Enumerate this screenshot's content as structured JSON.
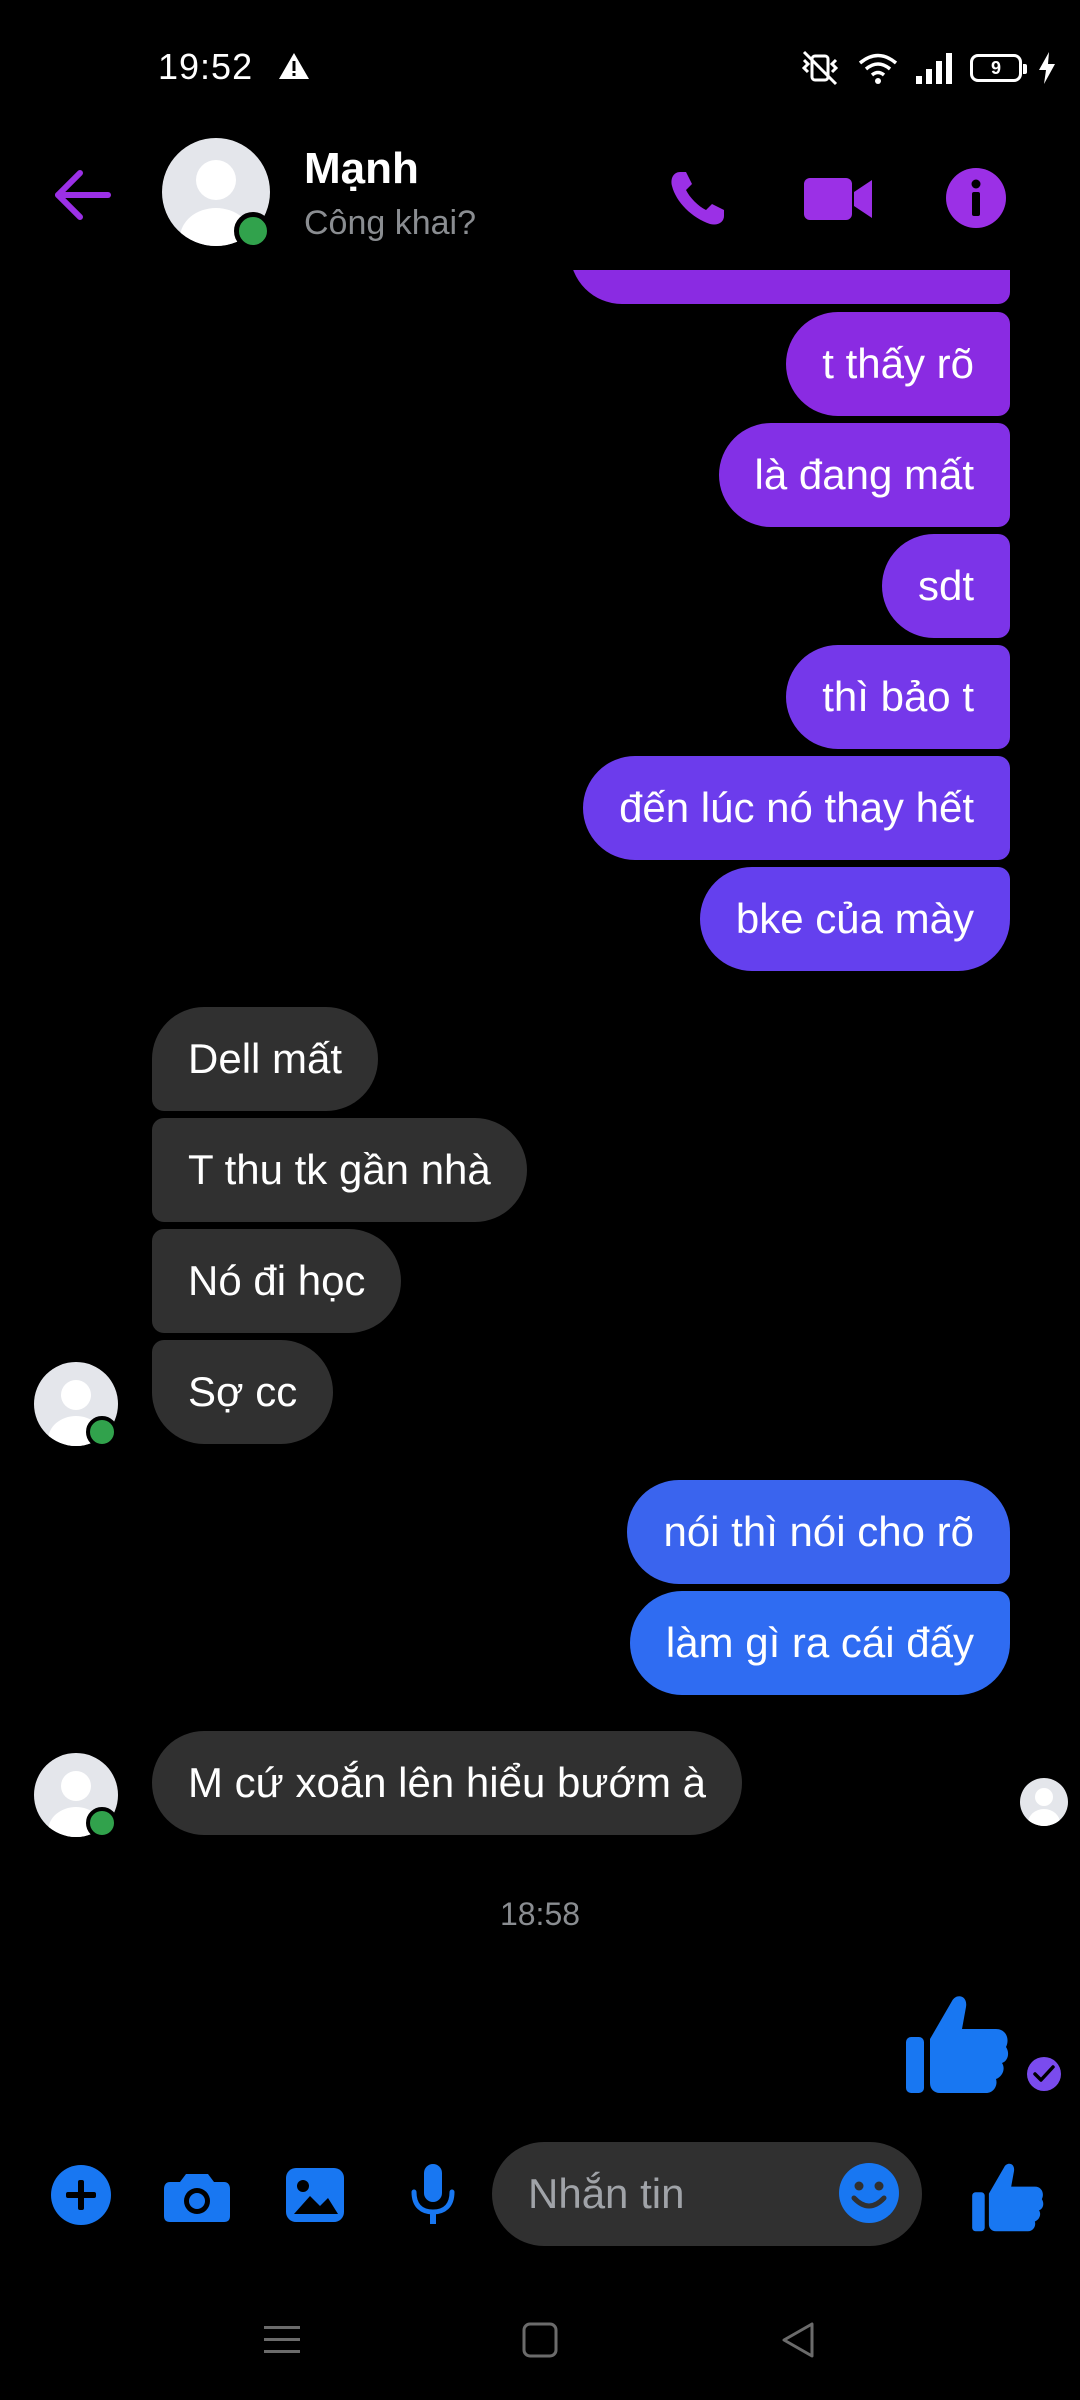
{
  "status_bar": {
    "time": "19:52",
    "battery_level": "9"
  },
  "header": {
    "contact_name": "Mạnh",
    "contact_status": "Công khai?"
  },
  "messages": [
    {
      "dir": "out",
      "text": "t thấy rõ"
    },
    {
      "dir": "out",
      "text": "là đang mất"
    },
    {
      "dir": "out",
      "text": "sdt"
    },
    {
      "dir": "out",
      "text": "thì bảo t"
    },
    {
      "dir": "out",
      "text": "đến lúc nó thay hết"
    },
    {
      "dir": "out",
      "text": "bke của mày"
    },
    {
      "dir": "in",
      "text": "Dell mất"
    },
    {
      "dir": "in",
      "text": "T thu tk gần nhà"
    },
    {
      "dir": "in",
      "text": "Nó đi học"
    },
    {
      "dir": "in",
      "text": "Sợ cc"
    },
    {
      "dir": "out",
      "text": "nói thì nói cho rõ"
    },
    {
      "dir": "out",
      "text": "làm gì ra cái đấy"
    },
    {
      "dir": "in",
      "text": "M cứ xoắn lên hiểu bướm à"
    }
  ],
  "thread": {
    "timestamp": "18:58"
  },
  "composer": {
    "placeholder": "Nhắn tin"
  },
  "colors": {
    "accent": "#8a2be2",
    "outgoing_blue": "#3a6ff0",
    "icon_blue": "#1877f2",
    "incoming": "#303030",
    "online": "#31a24c"
  }
}
